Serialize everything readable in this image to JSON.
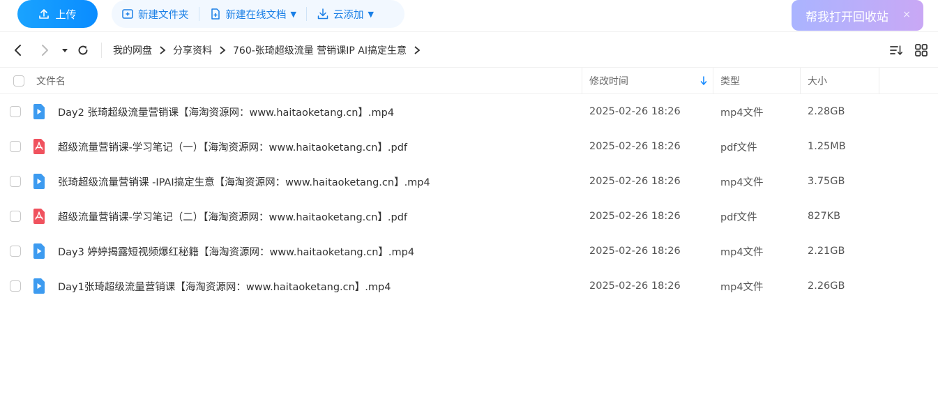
{
  "toolbar": {
    "upload_label": "上传",
    "new_folder_label": "新建文件夹",
    "new_doc_label": "新建在线文档",
    "cloud_add_label": "云添加",
    "recycle_promo": "帮我打开回收站",
    "close_glyph": "×"
  },
  "nav": {
    "breadcrumbs": [
      "我的网盘",
      "分享资料",
      "760-张琦超级流量 营销课IP AI搞定生意"
    ]
  },
  "table": {
    "headers": {
      "name": "文件名",
      "modified": "修改时间",
      "type": "类型",
      "size": "大小"
    },
    "rows": [
      {
        "name": "Day2 张琦超级流量营销课【海淘资源网：www.haitaoketang.cn】.mp4",
        "modified": "2025-02-26 18:26",
        "type": "mp4文件",
        "size": "2.28GB",
        "icon": "video-file-icon"
      },
      {
        "name": "超级流量营销课-学习笔记（一）【海淘资源网：www.haitaoketang.cn】.pdf",
        "modified": "2025-02-26 18:26",
        "type": "pdf文件",
        "size": "1.25MB",
        "icon": "pdf-file-icon"
      },
      {
        "name": "张琦超级流量营销课 -IPAI搞定生意【海淘资源网：www.haitaoketang.cn】.mp4",
        "modified": "2025-02-26 18:26",
        "type": "mp4文件",
        "size": "3.75GB",
        "icon": "video-file-icon"
      },
      {
        "name": "超级流量营销课-学习笔记（二）【海淘资源网：www.haitaoketang.cn】.pdf",
        "modified": "2025-02-26 18:26",
        "type": "pdf文件",
        "size": "827KB",
        "icon": "pdf-file-icon"
      },
      {
        "name": "Day3 婷婷揭露短视频爆红秘籍【海淘资源网：www.haitaoketang.cn】.mp4",
        "modified": "2025-02-26 18:26",
        "type": "mp4文件",
        "size": "2.21GB",
        "icon": "video-file-icon"
      },
      {
        "name": "Day1张琦超级流量营销课【海淘资源网：www.haitaoketang.cn】.mp4",
        "modified": "2025-02-26 18:26",
        "type": "mp4文件",
        "size": "2.26GB",
        "icon": "video-file-icon"
      }
    ]
  },
  "colors": {
    "accent": "#0a8cff",
    "video": "#3d9bf0",
    "pdf": "#f0525e"
  }
}
